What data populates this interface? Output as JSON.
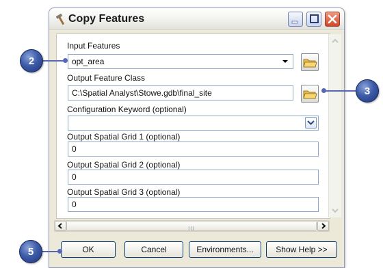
{
  "window": {
    "title": "Copy Features"
  },
  "title_icon": "hammer-icon",
  "title_buttons": [
    "minimize-icon",
    "maximize-icon",
    "close-icon"
  ],
  "form": {
    "input_features": {
      "label": "Input Features",
      "value": "opt_area"
    },
    "output_feature_class": {
      "label": "Output Feature Class",
      "value": "C:\\Spatial Analyst\\Stowe.gdb\\final_site"
    },
    "config_keyword": {
      "label": "Configuration Keyword (optional)",
      "value": ""
    },
    "grid1": {
      "label": "Output Spatial Grid 1 (optional)",
      "value": "0"
    },
    "grid2": {
      "label": "Output Spatial Grid 2 (optional)",
      "value": "0"
    },
    "grid3": {
      "label": "Output Spatial Grid 3 (optional)",
      "value": "0"
    }
  },
  "hscroll_grip": "III",
  "buttons": {
    "ok": "OK",
    "cancel": "Cancel",
    "environments": "Environments...",
    "show_help": "Show Help >>"
  },
  "callouts": {
    "input": "2",
    "output": "3",
    "ok": "5"
  },
  "colors": {
    "callout": "#3d5ba8",
    "leader": "#5668b5",
    "close_button": "#d04627",
    "window_bg": "#ece9d8"
  }
}
